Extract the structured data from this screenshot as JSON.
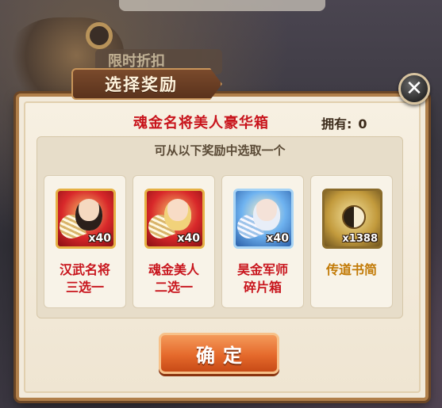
{
  "background": {
    "tab_text": "限时折扣"
  },
  "dialog": {
    "title": "选择奖励",
    "close_label": "✕",
    "chest_name": "魂金名将美人豪华箱",
    "owned_label": "拥有:",
    "owned_count": "0",
    "hint": "可从以下奖励中选取一个",
    "rewards": [
      {
        "icon": "general-portrait-icon",
        "quantity": "x40",
        "label": "汉武名将\n三选一",
        "label_color": "#c8141c"
      },
      {
        "icon": "beauty-portrait-icon",
        "quantity": "x40",
        "label": "魂金美人\n二选一",
        "label_color": "#c8141c"
      },
      {
        "icon": "strategist-portrait-icon",
        "quantity": "x40",
        "label": "昊金军师\n碎片箱",
        "label_color": "#c8141c"
      },
      {
        "icon": "scroll-icon",
        "quantity": "x1388",
        "label": "传道书简",
        "label_color": "#c27a06"
      }
    ],
    "confirm_label": "确定"
  },
  "colors": {
    "accent_red": "#c8141c",
    "accent_gold": "#c27a06",
    "button_orange": "#e56a2c",
    "frame_brown": "#b07f4a"
  }
}
